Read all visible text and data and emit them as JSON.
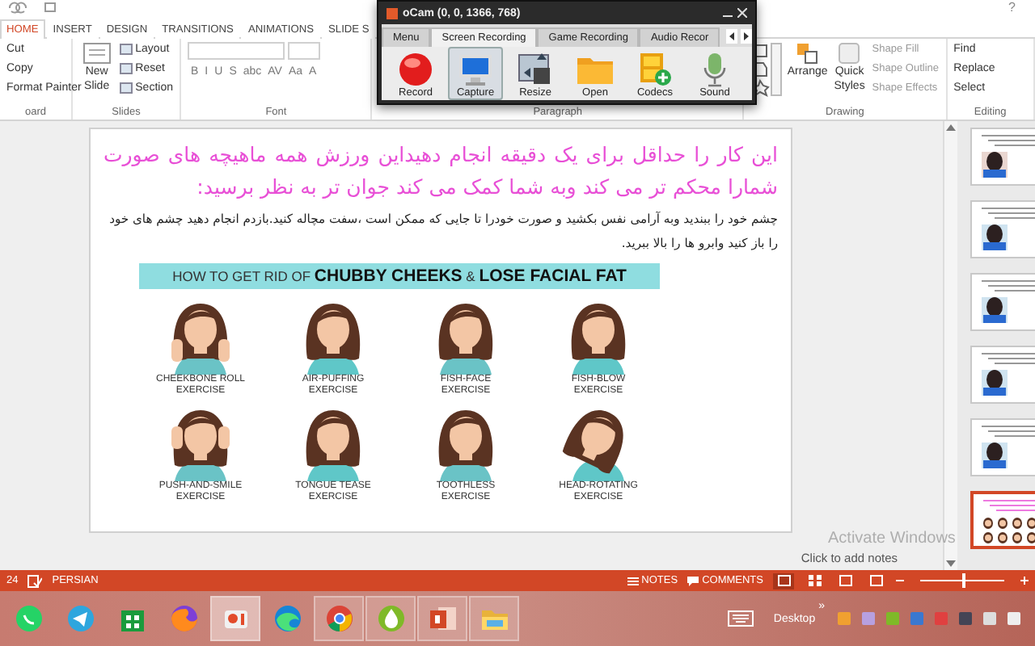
{
  "help": "?",
  "ribbon_tabs": [
    {
      "label": "HOME",
      "selected": true
    },
    {
      "label": "INSERT",
      "selected": false
    },
    {
      "label": "DESIGN",
      "selected": false
    },
    {
      "label": "TRANSITIONS",
      "selected": false
    },
    {
      "label": "ANIMATIONS",
      "selected": false
    },
    {
      "label": "SLIDE S",
      "selected": false
    }
  ],
  "ribbon": {
    "clipboard": {
      "items": [
        "Cut",
        "Copy",
        "Format Painter"
      ],
      "label": "oard"
    },
    "slides": {
      "new_slide": "New Slide",
      "items": [
        "Layout",
        "Reset",
        "Section"
      ],
      "label": "Slides"
    },
    "font": {
      "buttons": [
        "B",
        "I",
        "U",
        "S",
        "abc",
        "AV",
        "Aa",
        "A"
      ],
      "label": "Font"
    },
    "paragraph": {
      "label": "Paragraph"
    },
    "drawing": {
      "arrange": "Arrange",
      "quick_styles": "Quick Styles",
      "items": [
        "Shape Fill",
        "Shape Outline",
        "Shape Effects"
      ],
      "label": "Drawing"
    },
    "editing": {
      "items": [
        "Find",
        "Replace",
        "Select"
      ],
      "label": "Editing"
    }
  },
  "ocam": {
    "title": "oCam (0, 0, 1366, 768)",
    "tabs": [
      {
        "label": "Menu",
        "selected": false
      },
      {
        "label": "Screen Recording",
        "selected": true
      },
      {
        "label": "Game Recording",
        "selected": false
      },
      {
        "label": "Audio Recor",
        "selected": false
      }
    ],
    "tools": [
      {
        "label": "Record",
        "kind": "record",
        "selected": false
      },
      {
        "label": "Capture",
        "kind": "capture",
        "selected": true
      },
      {
        "label": "Resize",
        "kind": "resize",
        "selected": false
      },
      {
        "label": "Open",
        "kind": "open",
        "selected": false
      },
      {
        "label": "Codecs",
        "kind": "codecs",
        "selected": false
      },
      {
        "label": "Sound",
        "kind": "sound",
        "selected": false
      }
    ]
  },
  "slide": {
    "heading": "این کار را حداقل برای یک دقیقه انجام دهیداین ورزش همه ماهیچه های صورت شمارا محکم تر می کند وبه شما کمک می کند جوان تر به نظر برسید:",
    "body": "چشم خود را ببندید وبه آرامی نفس بکشید و صورت خودرا تا جایی که ممکن است ،سفت مچاله کنید.بازدم انجام دهید چشم های خود را باز کنید وابرو ها را بالا ببرید.",
    "infographic": {
      "title": "HOW TO GET RID OF **CHUBBY CHEEKS** & **LOSE FACIAL FAT**",
      "exercises": [
        {
          "name": "CHEEKBONE ROLL",
          "suffix": "EXERCISE"
        },
        {
          "name": "AIR-PUFFING",
          "suffix": "EXERCISE"
        },
        {
          "name": "FISH-FACE",
          "suffix": "EXERCISE"
        },
        {
          "name": "FISH-BLOW",
          "suffix": "EXERCISE"
        },
        {
          "name": "PUSH-AND-SMILE",
          "suffix": "EXERCISE"
        },
        {
          "name": "TONGUE TEASE",
          "suffix": "EXERCISE"
        },
        {
          "name": "TOOTHLESS",
          "suffix": "EXERCISE"
        },
        {
          "name": "HEAD-ROTATING",
          "suffix": "EXERCISE"
        }
      ]
    }
  },
  "notes_placeholder": "Click to add notes",
  "activation": "Activate Windows",
  "thumbnails": [
    {
      "selected": false
    },
    {
      "selected": false
    },
    {
      "selected": false
    },
    {
      "selected": false
    },
    {
      "selected": false
    },
    {
      "selected": true
    }
  ],
  "status_bar": {
    "slide": "24",
    "language": "PERSIAN",
    "notes": "NOTES",
    "comments": "COMMENTS",
    "views": [
      {
        "selected": true
      },
      {
        "selected": false
      },
      {
        "selected": false
      },
      {
        "selected": false
      }
    ],
    "zoom": {
      "level": 0.5
    }
  },
  "taskbar": {
    "apps": [
      {
        "kind": "chat",
        "running": false,
        "selected": false
      },
      {
        "kind": "plane",
        "running": false,
        "selected": false
      },
      {
        "kind": "store",
        "running": false,
        "selected": false
      },
      {
        "kind": "fox",
        "running": false,
        "selected": false
      },
      {
        "kind": "camera",
        "running": true,
        "selected": true
      },
      {
        "kind": "wave",
        "running": false,
        "selected": false
      },
      {
        "kind": "browser",
        "running": true,
        "selected": false
      },
      {
        "kind": "drop",
        "running": true,
        "selected": false
      },
      {
        "kind": "slides",
        "running": true,
        "selected": false
      },
      {
        "kind": "folder",
        "running": true,
        "selected": false
      }
    ],
    "desktop": "Desktop",
    "chevron": "»"
  }
}
